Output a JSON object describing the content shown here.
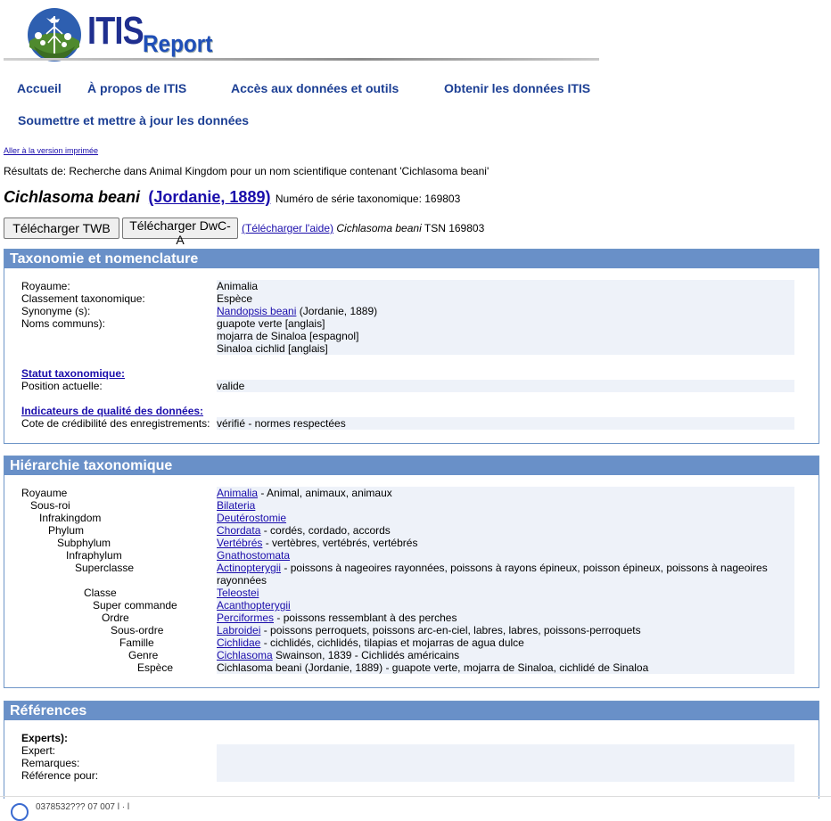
{
  "header": {
    "logo_text": "ITIS",
    "logo_subtitle": "Report"
  },
  "nav": {
    "home": "Accueil",
    "about": "À propos de ITIS",
    "access": "Accès aux données et outils",
    "obtain": "Obtenir les données ITIS",
    "submit": "Soumettre et mettre à jour les données"
  },
  "print_link": "Aller à la version imprimée",
  "results_text": "Résultats de: Recherche dans Animal Kingdom pour un nom scientifique contenant 'Cichlasoma beani'",
  "taxon": {
    "name": "Cichlasoma beani",
    "author": "(Jordanie, 1889)",
    "tsn_label": "Numéro de série taxonomique: 169803"
  },
  "buttons": {
    "twb": "Télécharger TWB",
    "dwca": "Télécharger DwC-A"
  },
  "download_help": {
    "link": "(Télécharger l'aide)",
    "name": "Cichlasoma beani",
    "tsn": "TSN 169803"
  },
  "taxonomy_section": {
    "title": "Taxonomie et nomenclature",
    "kingdom_label": "Royaume:",
    "kingdom_value": "Animalia",
    "rank_label": "Classement taxonomique:",
    "rank_value": "Espèce",
    "synonym_label": "Synonyme (s):",
    "synonym_link": "Nandopsis beani",
    "synonym_author": "(Jordanie, 1889)",
    "common_label": "Noms communs):",
    "common_names": [
      "guapote verte [anglais]",
      "mojarra de Sinaloa [espagnol]",
      "Sinaloa cichlid [anglais]"
    ],
    "status_heading": "Statut taxonomique:",
    "status_label": "Position actuelle:",
    "status_value": "valide",
    "quality_heading": "Indicateurs de qualité des données:",
    "quality_label": "Cote de crédibilité des enregistrements:",
    "quality_value": "vérifié - normes respectées"
  },
  "hierarchy_section": {
    "title": "Hiérarchie taxonomique",
    "rows": [
      {
        "rank": "Royaume",
        "name": "Animalia",
        "desc": "- Animal, animaux, animaux"
      },
      {
        "rank": "Sous-roi",
        "name": "Bilateria",
        "desc": ""
      },
      {
        "rank": "Infrakingdom",
        "name": "Deutérostomie",
        "desc": ""
      },
      {
        "rank": "Phylum",
        "name": "Chordata",
        "desc": "- cordés, cordado, accords"
      },
      {
        "rank": "Subphylum",
        "name": "Vertébrés",
        "desc": "- vertèbres, vertébrés, vertébrés"
      },
      {
        "rank": "Infraphylum",
        "name": "Gnathostomata",
        "desc": ""
      },
      {
        "rank": "Superclasse",
        "name": "Actinopterygii",
        "desc": "- poissons à nageoires rayonnées, poissons à rayons épineux, poisson épineux, poissons à nageoires rayonnées"
      },
      {
        "rank": "Classe",
        "name": "Teleostei",
        "desc": ""
      },
      {
        "rank": "Super commande",
        "name": "Acanthopterygii",
        "desc": ""
      },
      {
        "rank": "Ordre",
        "name": "Perciformes",
        "desc": "- poissons ressemblant à des perches"
      },
      {
        "rank": "Sous-ordre",
        "name": "Labroidei",
        "desc": "- poissons perroquets, poissons arc-en-ciel, labres, labres, poissons-perroquets"
      },
      {
        "rank": "Famille",
        "name": "Cichlidae",
        "desc": "- cichlidés, cichlidés, tilapias et mojarras de agua dulce"
      },
      {
        "rank": "Genre",
        "name": "Cichlasoma",
        "desc": "Swainson, 1839 - Cichlidés américains"
      },
      {
        "rank": "Espèce",
        "name": "",
        "desc": "Cichlasoma beani (Jordanie, 1889) - guapote verte, mojarra de Sinaloa, cichlidé de Sinaloa"
      }
    ]
  },
  "references_section": {
    "title": "Références",
    "experts_heading": "Experts):",
    "expert_label": "Expert:",
    "remarks_label": "Remarques:",
    "reference_label": "Référence pour:"
  },
  "footer": {
    "stub": "0378532??? 07 007 l   ·   l"
  }
}
